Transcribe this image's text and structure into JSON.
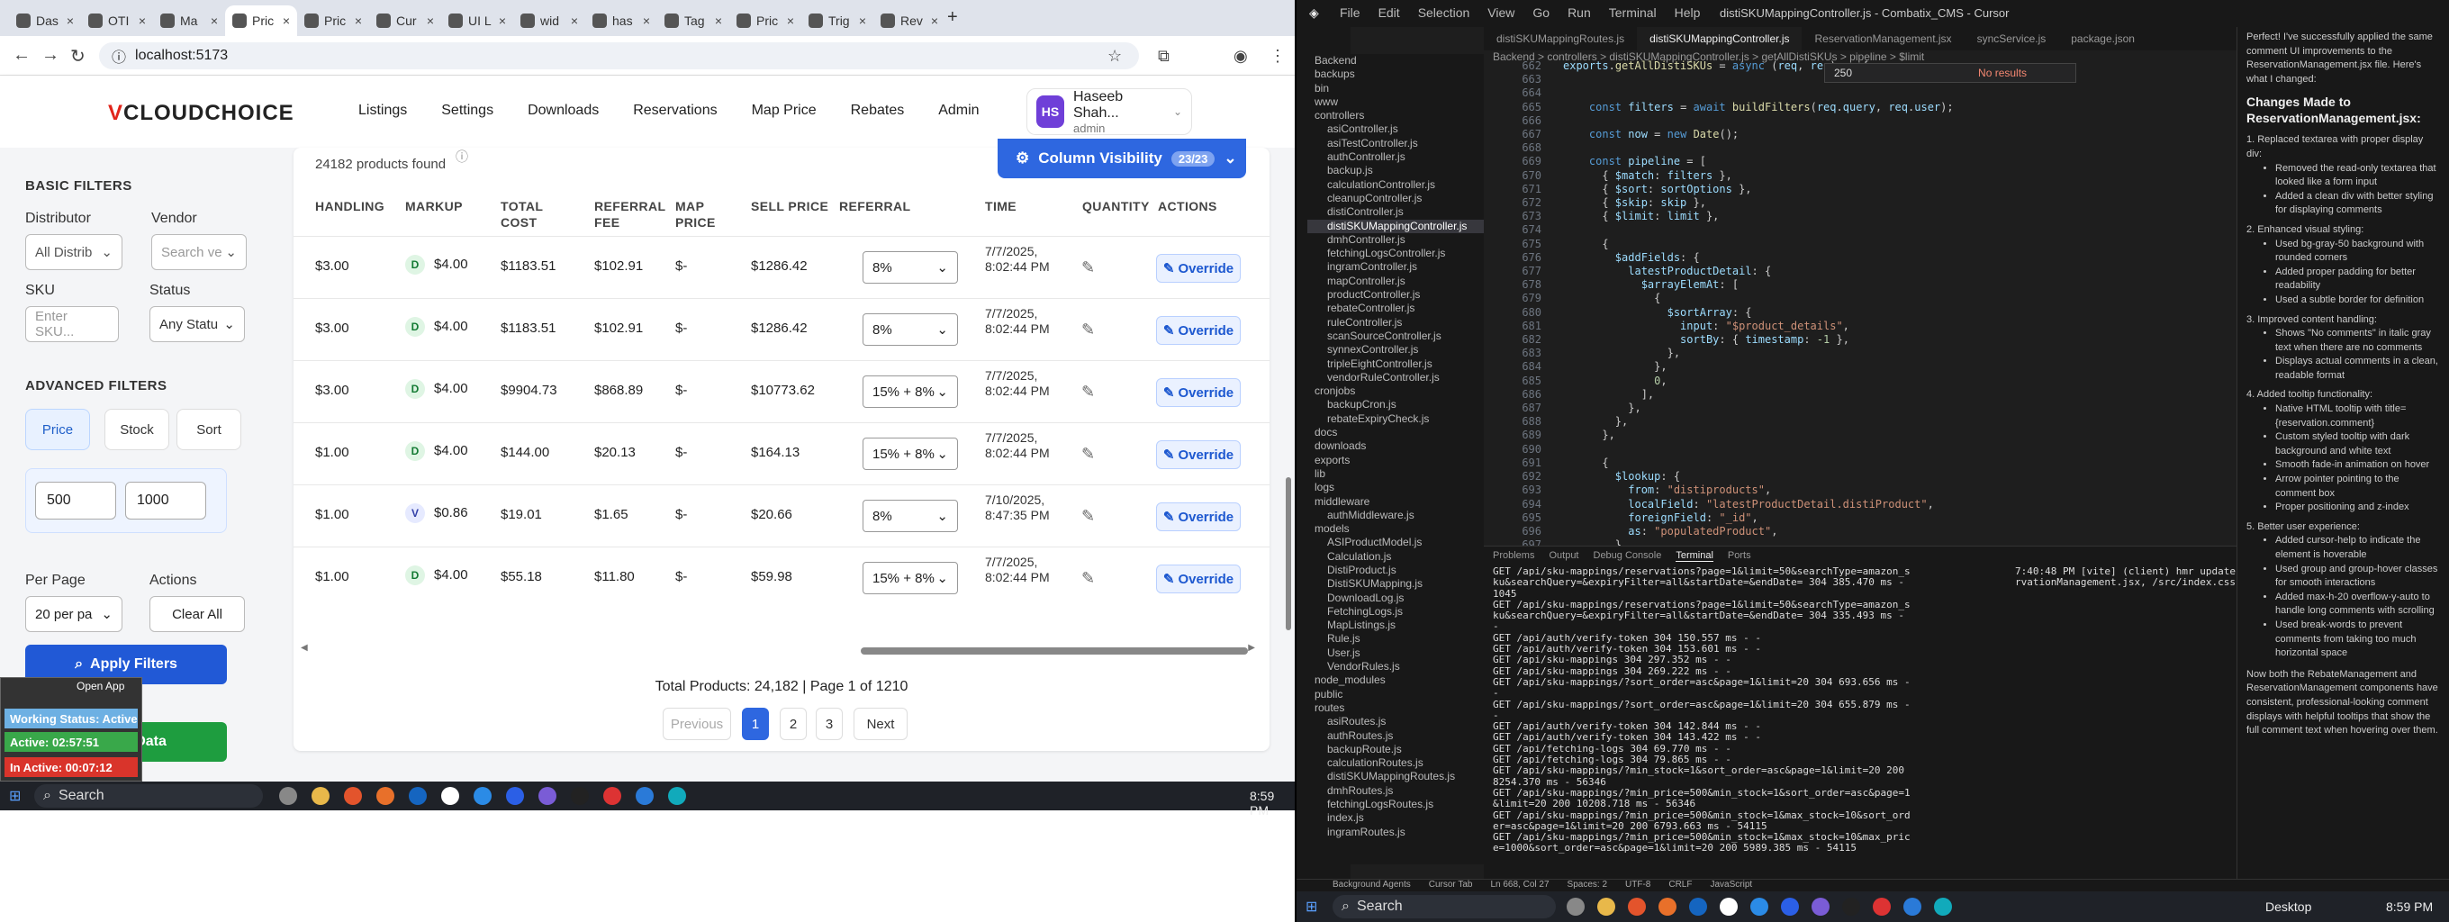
{
  "browser": {
    "tabs": [
      {
        "label": "Das"
      },
      {
        "label": "OTI"
      },
      {
        "label": "Ma"
      },
      {
        "label": "Pric"
      },
      {
        "label": "Pric"
      },
      {
        "label": "Cur"
      },
      {
        "label": "UI L"
      },
      {
        "label": "wid"
      },
      {
        "label": "has"
      },
      {
        "label": "Tag"
      },
      {
        "label": "Pric"
      },
      {
        "label": "Trig"
      },
      {
        "label": "Rev"
      }
    ],
    "url": "localhost:5173"
  },
  "header": {
    "logo_a": "V",
    "logo_b": "CLOUDCHOICE",
    "nav": [
      "Listings",
      "Settings",
      "Downloads",
      "Reservations",
      "Map Price",
      "Rebates",
      "Admin"
    ],
    "user": {
      "initials": "HS",
      "name": "Haseeb Shah...",
      "role": "admin"
    }
  },
  "filters": {
    "basic_title": "BASIC FILTERS",
    "distributor_label": "Distributor",
    "distributor_value": "All Distrib",
    "vendor_label": "Vendor",
    "vendor_placeholder": "Search ve",
    "sku_label": "SKU",
    "sku_placeholder": "Enter SKU...",
    "status_label": "Status",
    "status_value": "Any Statu",
    "advanced_title": "ADVANCED FILTERS",
    "tabs": [
      "Price",
      "Stock",
      "Sort"
    ],
    "min": "500",
    "max": "1000",
    "per_page_label": "Per Page",
    "per_page_value": "20 per pa",
    "actions_label": "Actions",
    "clear": "Clear All",
    "apply": "Apply Filters",
    "export": "Export Data"
  },
  "table": {
    "found": "24182 products found",
    "colvis": "Column Visibility",
    "colvis_count": "23/23",
    "headers": [
      "HANDLING",
      "MARKUP",
      "TOTAL COST",
      "REFERRAL FEE",
      "MAP PRICE",
      "SELL PRICE",
      "REFERRAL",
      "TIME",
      "QUANTITY",
      "ACTIONS"
    ],
    "rows": [
      {
        "handling": "$3.00",
        "mk": "D",
        "markup": "$4.00",
        "total": "$1183.51",
        "fee": "$102.91",
        "map": "$-",
        "sell": "$1286.42",
        "ref": "8%",
        "time": "7/7/2025, 8:02:44 PM"
      },
      {
        "handling": "$3.00",
        "mk": "D",
        "markup": "$4.00",
        "total": "$1183.51",
        "fee": "$102.91",
        "map": "$-",
        "sell": "$1286.42",
        "ref": "8%",
        "time": "7/7/2025, 8:02:44 PM"
      },
      {
        "handling": "$3.00",
        "mk": "D",
        "markup": "$4.00",
        "total": "$9904.73",
        "fee": "$868.89",
        "map": "$-",
        "sell": "$10773.62",
        "ref": "15% + 8%",
        "time": "7/7/2025, 8:02:44 PM"
      },
      {
        "handling": "$1.00",
        "mk": "D",
        "markup": "$4.00",
        "total": "$144.00",
        "fee": "$20.13",
        "map": "$-",
        "sell": "$164.13",
        "ref": "15% + 8%",
        "time": "7/7/2025, 8:02:44 PM"
      },
      {
        "handling": "$1.00",
        "mk": "V",
        "markup": "$0.86",
        "total": "$19.01",
        "fee": "$1.65",
        "map": "$-",
        "sell": "$20.66",
        "ref": "8%",
        "time": "7/10/2025, 8:47:35 PM"
      },
      {
        "handling": "$1.00",
        "mk": "D",
        "markup": "$4.00",
        "total": "$55.18",
        "fee": "$11.80",
        "map": "$-",
        "sell": "$59.98",
        "ref": "15% + 8%",
        "time": "7/7/2025, 8:02:44 PM"
      }
    ],
    "override": "Override",
    "totals": "Total Products: 24,182 | Page 1 of 1210",
    "pager": [
      "Previous",
      "1",
      "2",
      "3",
      "Next"
    ]
  },
  "widget": {
    "open": "Open App",
    "working": "Working Status: Active",
    "active": "Active: 02:57:51",
    "inactive": "In Active: 00:07:12"
  },
  "taskbar": {
    "search": "Search",
    "time": "8:59 PM"
  },
  "editor": {
    "menu": [
      "File",
      "Edit",
      "Selection",
      "View",
      "Go",
      "Run",
      "Terminal",
      "Help"
    ],
    "title": "distiSKUMappingController.js - Combatix_CMS - Cursor",
    "tabs": [
      "distiSKUMappingRoutes.js",
      "distiSKUMappingController.js",
      "ReservationManagement.jsx",
      "syncService.js",
      "package.json"
    ],
    "breadcrumb": "Backend > controllers > distiSKUMappingController.js > getAllDistiSKUs > pipeline > $limit",
    "find": "250",
    "find_result": "No results",
    "explorer": [
      "Backend",
      "backups",
      "bin",
      "www",
      "controllers",
      "asiController.js",
      "asiTestController.js",
      "authController.js",
      "backup.js",
      "calculationController.js",
      "cleanupController.js",
      "distiController.js",
      "distiSKUMappingController.js",
      "dmhController.js",
      "fetchingLogsController.js",
      "ingramController.js",
      "mapController.js",
      "productController.js",
      "rebateController.js",
      "ruleController.js",
      "scanSourceController.js",
      "synnexController.js",
      "tripleEightController.js",
      "vendorRuleController.js",
      "cronjobs",
      "backupCron.js",
      "rebateExpiryCheck.js",
      "docs",
      "downloads",
      "exports",
      "lib",
      "logs",
      "middleware",
      "authMiddleware.js",
      "models",
      "ASIProductModel.js",
      "Calculation.js",
      "DistiProduct.js",
      "DistiSKUMapping.js",
      "DownloadLog.js",
      "FetchingLogs.js",
      "MapListings.js",
      "Rule.js",
      "User.js",
      "VendorRules.js",
      "node_modules",
      "public",
      "routes",
      "asiRoutes.js",
      "authRoutes.js",
      "backupRoute.js",
      "calculationRoutes.js",
      "distiSKUMappingRoutes.js",
      "dmhRoutes.js",
      "fetchingLogsRoutes.js",
      "index.js",
      "ingramRoutes.js"
    ],
    "code_start": 662,
    "panel_tabs": [
      "Problems",
      "Output",
      "Debug Console",
      "Terminal",
      "Ports"
    ],
    "term": [
      "GET /api/sku-mappings/reservations?page=1&limit=50&searchType=amazon_s",
      "ku&searchQuery=&expiryFilter=all&startDate=&endDate= 304 385.470 ms -",
      "1045",
      "GET /api/sku-mappings/reservations?page=1&limit=50&searchType=amazon_s",
      "ku&searchQuery=&expiryFilter=all&startDate=&endDate= 304 335.493 ms -",
      "-",
      "GET /api/auth/verify-token 304 150.557 ms - -",
      "GET /api/auth/verify-token 304 153.601 ms - -",
      "GET /api/sku-mappings 304 297.352 ms - -",
      "GET /api/sku-mappings 304 269.222 ms - -",
      "GET /api/sku-mappings/?sort_order=asc&page=1&limit=20 304 693.656 ms -",
      "-",
      "GET /api/sku-mappings/?sort_order=asc&page=1&limit=20 304 655.879 ms -",
      "-",
      "GET /api/auth/verify-token 304 142.844 ms - -",
      "GET /api/auth/verify-token 304 143.422 ms - -",
      "GET /api/fetching-logs 304 69.770 ms - -",
      "GET /api/fetching-logs 304 79.865 ms - -",
      "GET /api/sku-mappings/?min_stock=1&sort_order=asc&page=1&limit=20 200",
      "8254.370 ms - 56346",
      "GET /api/sku-mappings/?min_price=500&min_stock=1&sort_order=asc&page=1",
      "&limit=20 200 10208.718 ms - 56346",
      "GET /api/sku-mappings/?min_price=500&min_stock=1&max_stock=10&sort_ord",
      "er=asc&page=1&limit=20 200 6793.663 ms - 54115",
      "GET /api/sku-mappings/?min_price=500&min_stock=1&max_stock=10&max_pric",
      "e=1000&sort_order=asc&page=1&limit=20 200 5989.385 ms - 54115"
    ],
    "term2": [
      "7:40:48 PM [vite] (client) hmr update /src/pages/ReservationsPage/Rese",
      "rvationManagement.jsx, /src/index.css"
    ],
    "chat_intro": "Perfect! I've successfully applied the same comment UI improvements to the ReservationManagement.jsx file. Here's what I changed:",
    "chat_title": "Changes Made to ReservationManagement.jsx:",
    "chat_items": [
      "1. Replaced textarea with proper display div:",
      "Removed the read-only textarea that looked like a form input",
      "Added a clean div with better styling for displaying comments",
      "2. Enhanced visual styling:",
      "Used bg-gray-50 background with rounded corners",
      "Added proper padding for better readability",
      "Used a subtle border for definition",
      "3. Improved content handling:",
      "Shows \"No comments\" in italic gray text when there are no comments",
      "Displays actual comments in a clean, readable format",
      "4. Added tooltip functionality:",
      "Native HTML tooltip with title={reservation.comment}",
      "Custom styled tooltip with dark background and white text",
      "Smooth fade-in animation on hover",
      "Arrow pointer pointing to the comment box",
      "Proper positioning and z-index",
      "5. Better user experience:",
      "Added cursor-help to indicate the element is hoverable",
      "Used group and group-hover classes for smooth interactions",
      "Added max-h-20 overflow-y-auto to handle long comments with scrolling",
      "Used break-words to prevent comments from taking too much horizontal space"
    ],
    "chat_outro": "Now both the RebateManagement and ReservationManagement components have consistent, professional-looking comment displays with helpful tooltips that show the full comment text when hovering over them.",
    "status": [
      "Background Agents",
      "Cursor Tab",
      "Ln 668, Col 27",
      "Spaces: 2",
      "UTF-8",
      "CRLF",
      "JavaScript"
    ]
  },
  "rtaskbar": {
    "search": "Search",
    "desktop": "Desktop",
    "time": "8:59 PM"
  }
}
